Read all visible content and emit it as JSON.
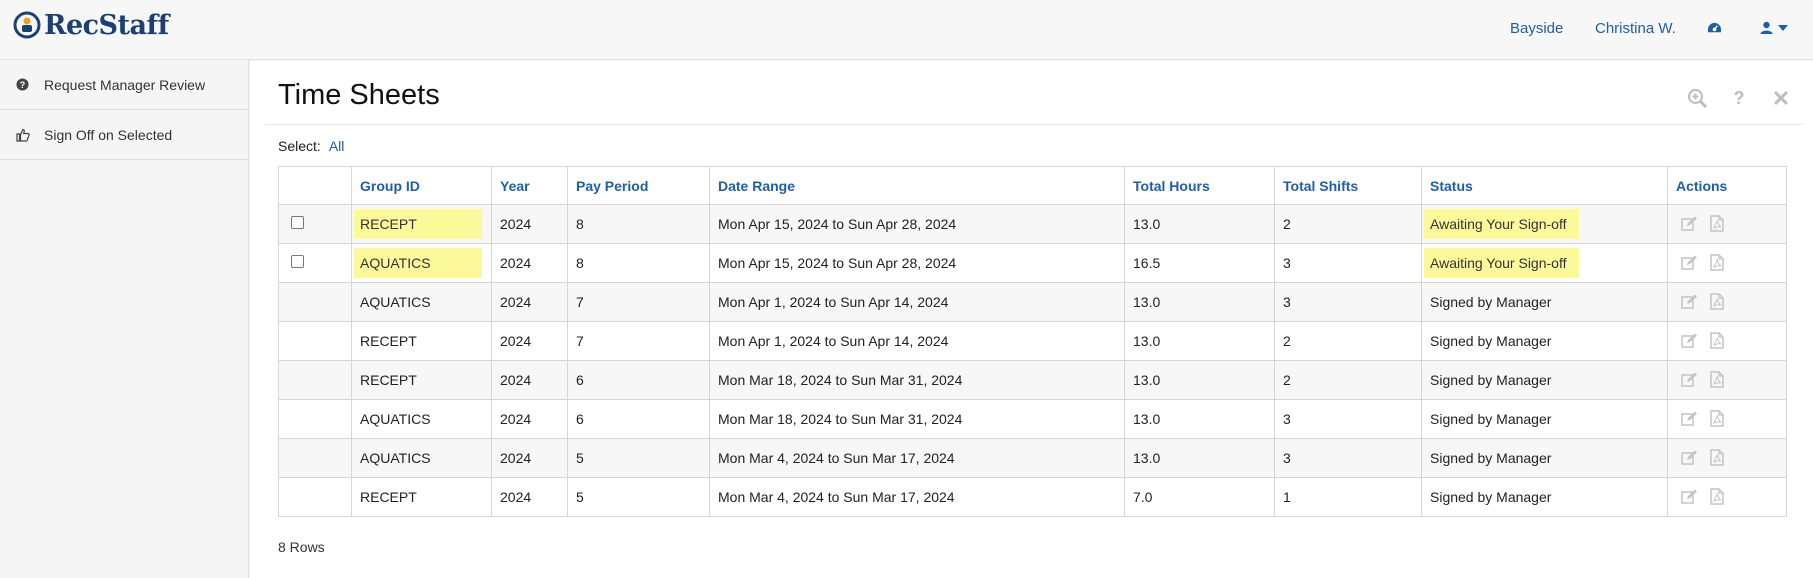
{
  "app": {
    "logo_text": "RecStaff"
  },
  "topnav": {
    "location": "Bayside",
    "user_name": "Christina W."
  },
  "sidebar": {
    "items": [
      {
        "label": "Request Manager Review",
        "icon": "question-circle-icon"
      },
      {
        "label": "Sign Off on Selected",
        "icon": "thumbs-up-icon"
      }
    ]
  },
  "page": {
    "title": "Time Sheets",
    "select_label": "Select:",
    "select_all": "All",
    "row_count": "8 Rows"
  },
  "table": {
    "headers": [
      "Group ID",
      "Year",
      "Pay Period",
      "Date Range",
      "Total Hours",
      "Total Shifts",
      "Status",
      "Actions"
    ],
    "rows": [
      {
        "group": "RECEPT",
        "year": "2024",
        "period": "8",
        "range": "Mon Apr 15, 2024 to Sun Apr 28, 2024",
        "hours": "13.0",
        "shifts": "2",
        "status": "Awaiting Your Sign-off",
        "selectable": true
      },
      {
        "group": "AQUATICS",
        "year": "2024",
        "period": "8",
        "range": "Mon Apr 15, 2024 to Sun Apr 28, 2024",
        "hours": "16.5",
        "shifts": "3",
        "status": "Awaiting Your Sign-off",
        "selectable": true
      },
      {
        "group": "AQUATICS",
        "year": "2024",
        "period": "7",
        "range": "Mon Apr 1, 2024 to Sun Apr 14, 2024",
        "hours": "13.0",
        "shifts": "3",
        "status": "Signed by Manager",
        "selectable": false
      },
      {
        "group": "RECEPT",
        "year": "2024",
        "period": "7",
        "range": "Mon Apr 1, 2024 to Sun Apr 14, 2024",
        "hours": "13.0",
        "shifts": "2",
        "status": "Signed by Manager",
        "selectable": false
      },
      {
        "group": "RECEPT",
        "year": "2024",
        "period": "6",
        "range": "Mon Mar 18, 2024 to Sun Mar 31, 2024",
        "hours": "13.0",
        "shifts": "2",
        "status": "Signed by Manager",
        "selectable": false
      },
      {
        "group": "AQUATICS",
        "year": "2024",
        "period": "6",
        "range": "Mon Mar 18, 2024 to Sun Mar 31, 2024",
        "hours": "13.0",
        "shifts": "3",
        "status": "Signed by Manager",
        "selectable": false
      },
      {
        "group": "AQUATICS",
        "year": "2024",
        "period": "5",
        "range": "Mon Mar 4, 2024 to Sun Mar 17, 2024",
        "hours": "13.0",
        "shifts": "3",
        "status": "Signed by Manager",
        "selectable": false
      },
      {
        "group": "RECEPT",
        "year": "2024",
        "period": "5",
        "range": "Mon Mar 4, 2024 to Sun Mar 17, 2024",
        "hours": "7.0",
        "shifts": "1",
        "status": "Signed by Manager",
        "selectable": false
      }
    ]
  },
  "colors": {
    "brand": "#1d3f73",
    "link": "#1f5fa8",
    "highlight": "#fbf99a",
    "muted_icon": "#bdbdbd"
  }
}
